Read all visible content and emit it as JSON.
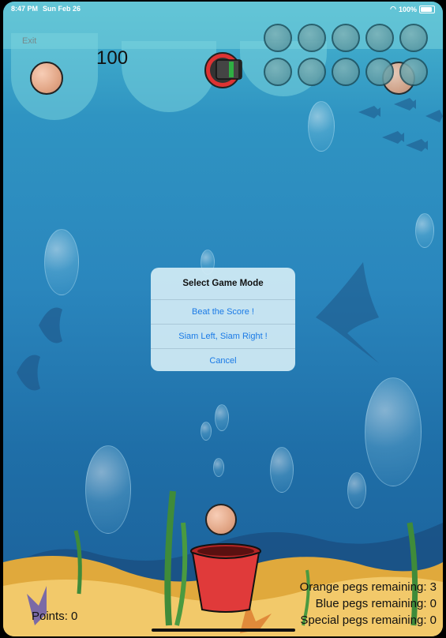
{
  "status_bar": {
    "time": "8:47 PM",
    "date": "Sun Feb 26",
    "battery": "100%"
  },
  "hud": {
    "exit_label": "Exit",
    "score": "100"
  },
  "dialog": {
    "title": "Select Game Mode",
    "options": [
      "Beat the Score !",
      "Siam Left, Siam Right !",
      "Cancel"
    ]
  },
  "footer": {
    "points": "Points: 0",
    "orange_pegs": "Orange pegs remaining: 3",
    "blue_pegs": "Blue pegs remaining: 0",
    "special_pegs": "Special pegs remaining: 0"
  },
  "colors": {
    "dialog_link": "#1a7ae6",
    "bucket": "#e03a3a",
    "peg": "#e8b198"
  }
}
